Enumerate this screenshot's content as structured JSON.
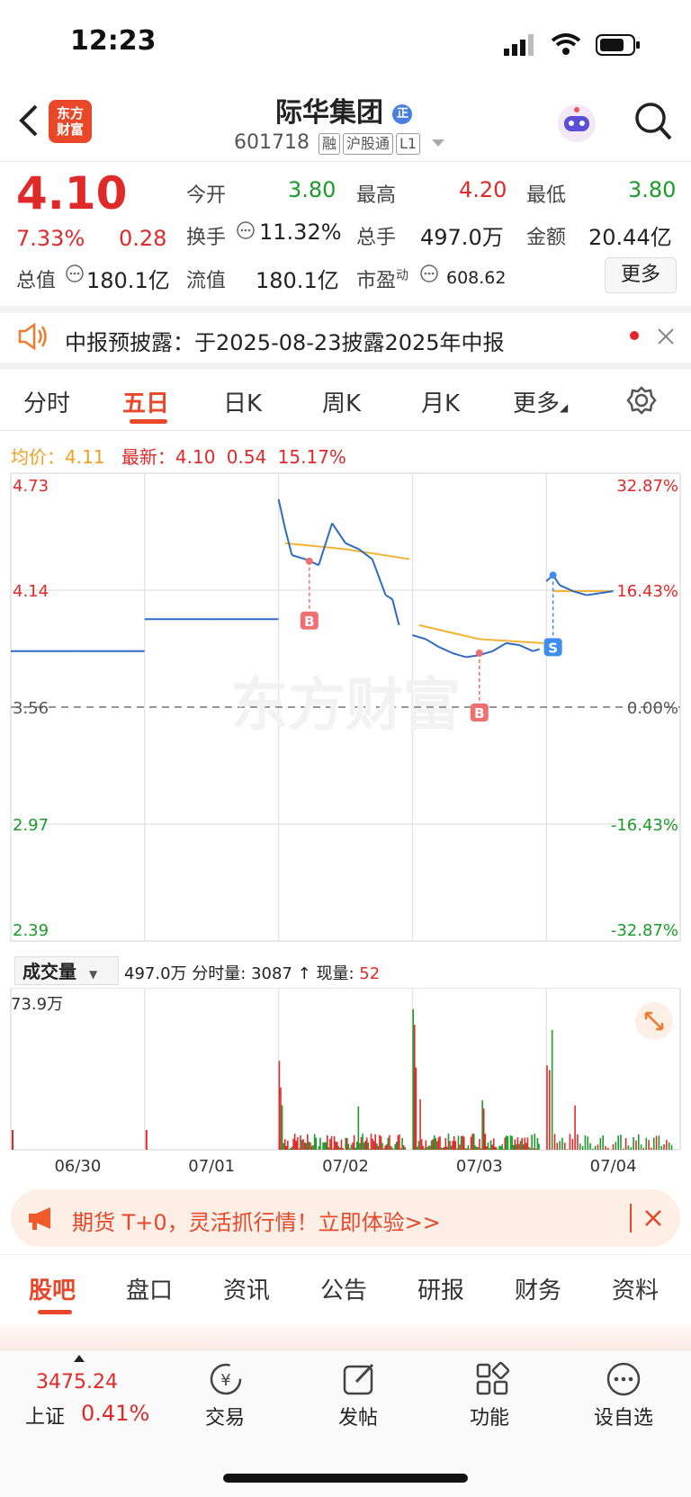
{
  "status_bar": {
    "time": "12:23"
  },
  "header": {
    "logo_text_1": "东方",
    "logo_text_2": "财富",
    "stock_name": "际华集团",
    "name_badge": "正",
    "stock_code": "601718",
    "tag_rong": "融",
    "tag_hugutong": "沪股通",
    "tag_level": "L1"
  },
  "quote": {
    "price": "4.10",
    "change_pct": "7.33%",
    "change": "0.28",
    "open_label": "今开",
    "open": "3.80",
    "high_label": "最高",
    "high": "4.20",
    "low_label": "最低",
    "low": "3.80",
    "turnover_label": "换手",
    "turnover": "11.32%",
    "volume_label": "总手",
    "volume": "497.0万",
    "amount_label": "金额",
    "amount": "20.44亿",
    "mktcap_label": "总值",
    "mktcap": "180.1亿",
    "float_label": "流值",
    "float_cap": "180.1亿",
    "pe_label": "市盈",
    "pe_sup": "动",
    "pe": "608.62",
    "more_button": "更多"
  },
  "notice": {
    "text": "中报预披露：于2025-08-23披露2025年中报"
  },
  "chart_tabs": [
    "分时",
    "五日",
    "日K",
    "周K",
    "月K",
    "更多"
  ],
  "active_tab": "五日",
  "chart_info": {
    "avg_label": "均价：",
    "avg": "4.11",
    "latest_label": "最新：",
    "latest": "4.10",
    "latest_change": "0.54",
    "latest_pct": "15.17%"
  },
  "chart_data": {
    "type": "line",
    "title": "",
    "y_left_ticks": [
      "4.73",
      "4.14",
      "3.56",
      "2.97",
      "2.39"
    ],
    "y_right_ticks": [
      "32.87%",
      "16.43%",
      "0.00%",
      "-16.43%",
      "-32.87%"
    ],
    "ylim": [
      2.39,
      4.73
    ],
    "prev_close": 3.56,
    "x_ticks": [
      "06/30",
      "07/01",
      "07/02",
      "07/03",
      "07/04"
    ],
    "series": [
      {
        "name": "",
        "x": [
          0,
          0.5,
          0.999,
          1.0,
          1.5,
          1.999,
          2.0,
          2.05,
          2.1,
          2.2,
          2.3,
          2.4,
          2.5,
          2.6,
          2.7,
          2.8,
          2.85,
          2.9,
          3.0,
          3.1,
          3.2,
          3.3,
          3.4,
          3.5,
          3.6,
          3.7,
          3.8,
          3.9,
          3.95,
          4.0,
          4.05,
          4.1,
          4.2,
          4.3,
          4.4,
          4.5
        ],
        "y": [
          3.84,
          3.84,
          3.84,
          4.0,
          4.0,
          4.0,
          4.6,
          4.45,
          4.32,
          4.3,
          4.27,
          4.48,
          4.38,
          4.35,
          4.3,
          4.12,
          4.1,
          3.97,
          3.92,
          3.9,
          3.86,
          3.83,
          3.81,
          3.82,
          3.84,
          3.88,
          3.87,
          3.84,
          3.85,
          4.19,
          4.22,
          4.17,
          4.14,
          4.12,
          4.13,
          4.14
        ]
      },
      {
        "name": "",
        "x": [
          2.05,
          2.5,
          2.98
        ],
        "y": [
          4.38,
          4.35,
          4.3
        ]
      },
      {
        "name": "",
        "x": [
          3.05,
          3.5,
          3.98
        ],
        "y": [
          3.97,
          3.9,
          3.88
        ]
      },
      {
        "name": "",
        "x": [
          4.05,
          4.5
        ],
        "y": [
          4.14,
          4.14
        ]
      }
    ],
    "markers": [
      {
        "label": "B",
        "x": 2.23,
        "y": 4.29
      },
      {
        "label": "B",
        "x": 3.5,
        "y": 3.83
      },
      {
        "label": "S",
        "x": 4.05,
        "y": 4.22
      }
    ],
    "colors": {
      "price": "#2f6bc4",
      "avg": "#f3b233",
      "buy": "#f07070",
      "sell": "#3d8ef0"
    }
  },
  "volume": {
    "selector": "成交量",
    "total": "497.0万",
    "minute_vol_label": "分时量:",
    "minute_vol": "3087",
    "current_label": "现量:",
    "current": "52",
    "ymax_label": "73.9万"
  },
  "promo": {
    "text": "期货 T+0，灵活抓行情！立即体验>>"
  },
  "bottom_tabs": [
    "股吧",
    "盘口",
    "资讯",
    "公告",
    "研报",
    "财务",
    "资料"
  ],
  "bottom_active": "股吧",
  "nav": {
    "index_value": "3475.24",
    "index_name": "上证",
    "index_pct": "0.41%",
    "trade": "交易",
    "post": "发帖",
    "function": "功能",
    "watchlist": "设自选"
  },
  "watermark": "东方财富"
}
